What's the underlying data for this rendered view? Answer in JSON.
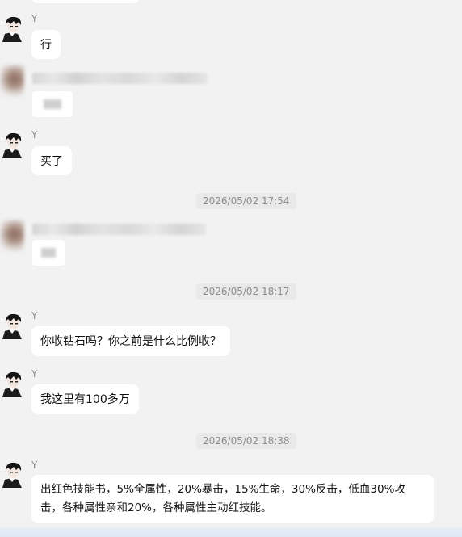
{
  "chat": {
    "timestamps": [
      "2026/05/02 17:54",
      "2026/05/02 18:17",
      "2026/05/02 18:38"
    ],
    "messages": [
      {
        "sender": "Y",
        "text": "行"
      },
      {
        "sender": "Y",
        "text": "买了"
      },
      {
        "sender": "Y",
        "text": "你收钻石吗？你之前是什么比例收？"
      },
      {
        "sender": "Y",
        "text": "我这里有100多万"
      },
      {
        "sender": "Y",
        "text": "出红色技能书，5%全属性，20%暴击，15%生命，30%反击，低血30%攻击，各种属性亲和20%，各种属性主动红技能。"
      }
    ]
  },
  "icons": {
    "avatar": "anime-boy-avatar-icon",
    "contact": "blurred-avatar-icon"
  }
}
